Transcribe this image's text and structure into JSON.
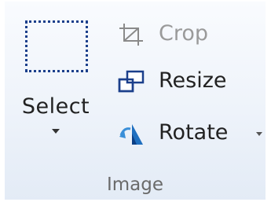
{
  "ribbon": {
    "group_label": "Image",
    "select": {
      "label": "Select",
      "icon": "dotted-rectangle-selection-icon"
    },
    "commands": [
      {
        "label": "Crop",
        "icon": "crop-icon",
        "enabled": false
      },
      {
        "label": "Resize",
        "icon": "resize-icon",
        "enabled": true
      },
      {
        "label": "Rotate",
        "icon": "rotate-icon",
        "enabled": true,
        "has_dropdown": true
      }
    ]
  },
  "colors": {
    "icon_blue": "#1b3f8b",
    "icon_light_blue": "#3a8fd8",
    "disabled_text": "#9a9a9a",
    "group_label_text": "#6a6a6a"
  }
}
